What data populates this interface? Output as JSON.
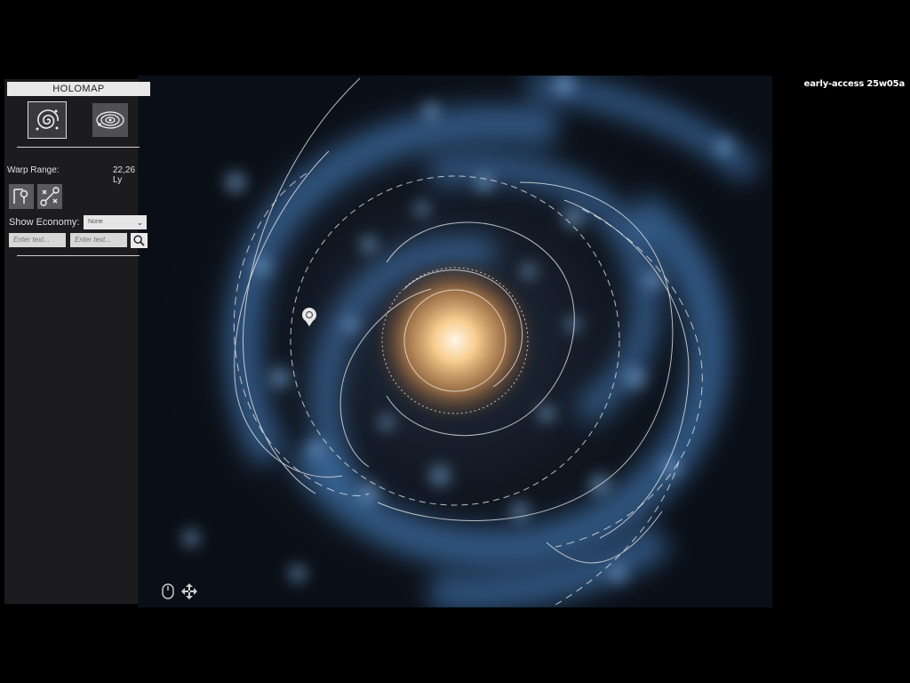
{
  "version": "early-access 25w05a",
  "panel": {
    "title": "HOLOMAP",
    "modes": [
      {
        "name": "spiral-view",
        "active": true
      },
      {
        "name": "orbit-view",
        "active": false
      }
    ],
    "warp_range": {
      "label": "Warp Range:",
      "value": "22,26 Ly"
    },
    "tools": [
      "pin-tool-icon",
      "route-tool-icon"
    ],
    "economy": {
      "label": "Show Economy:",
      "selected": "None"
    },
    "search": {
      "placeholder_1": "Enter text...",
      "placeholder_2": "Enter text..."
    }
  },
  "map": {
    "controls": [
      "mouse-icon",
      "pan-arrows-icon"
    ],
    "colors": {
      "core": "#f4c27a",
      "arms": "#5b8fc7",
      "contours": "#e6e6e6",
      "background": "#0b1018"
    }
  }
}
